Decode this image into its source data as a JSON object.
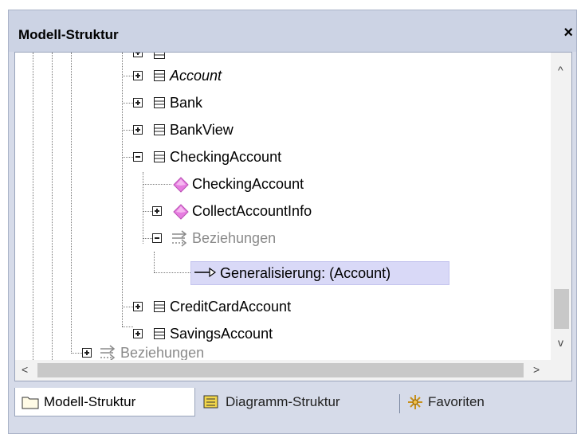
{
  "panel": {
    "title": "Modell-Struktur",
    "close_symbol": "×"
  },
  "tree": {
    "nodes": [
      {
        "label": "Account",
        "icon": "class-icon",
        "expander": "plus",
        "italic": true
      },
      {
        "label": "Bank",
        "icon": "class-icon",
        "expander": "plus"
      },
      {
        "label": "BankView",
        "icon": "class-icon",
        "expander": "plus"
      },
      {
        "label": "CheckingAccount",
        "icon": "class-icon",
        "expander": "minus"
      },
      {
        "label": "CheckingAccount",
        "icon": "operation-icon"
      },
      {
        "label": "CollectAccountInfo",
        "icon": "operation-icon",
        "expander": "plus"
      },
      {
        "label": "Beziehungen",
        "icon": "relations-icon",
        "expander": "minus",
        "gray": true
      },
      {
        "label": "Generalisierung:  (Account)",
        "icon": "generalization-arrow-icon",
        "selected": true
      },
      {
        "label": "CreditCardAccount",
        "icon": "class-icon",
        "expander": "plus"
      },
      {
        "label": "SavingsAccount",
        "icon": "class-icon",
        "expander": "plus"
      },
      {
        "label": "Beziehungen",
        "icon": "relations-icon",
        "expander": "plus",
        "gray": true
      }
    ]
  },
  "scrollbar": {
    "up": "^",
    "down": "v",
    "left": "<",
    "right": ">"
  },
  "tabs": [
    {
      "label": "Modell-Struktur",
      "icon": "folder-icon",
      "active": true
    },
    {
      "label": "Diagramm-Struktur",
      "icon": "diagram-tree-icon",
      "active": false
    },
    {
      "label": "Favoriten",
      "icon": "favorites-icon",
      "active": false
    }
  ],
  "colors": {
    "selection": "#d9d9f7",
    "operation_icon": "#e67ce0",
    "titlebar": "#ccd3e4"
  }
}
